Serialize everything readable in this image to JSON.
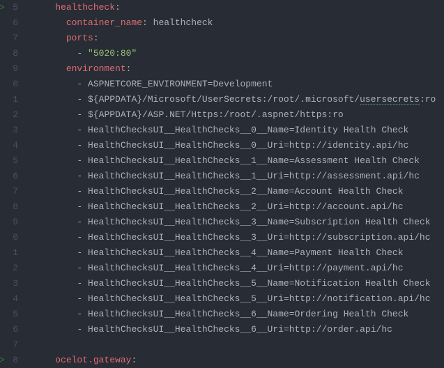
{
  "lineStart": 5,
  "lines": [
    {
      "indent": 2,
      "type": "key",
      "key": "healthcheck",
      "run": true
    },
    {
      "indent": 3,
      "type": "kv",
      "key": "container_name",
      "value": "healthcheck"
    },
    {
      "indent": 3,
      "type": "key",
      "key": "ports"
    },
    {
      "indent": 4,
      "type": "item-str",
      "value": "\"5020:80\""
    },
    {
      "indent": 3,
      "type": "key",
      "key": "environment"
    },
    {
      "indent": 4,
      "type": "item",
      "value": "ASPNETCORE_ENVIRONMENT=Development"
    },
    {
      "indent": 4,
      "type": "item-sq",
      "pre": "${APPDATA}/Microsoft/UserSecrets:/root/.microsoft/",
      "sq": "usersecrets",
      "post": ":ro"
    },
    {
      "indent": 4,
      "type": "item",
      "value": "${APPDATA}/ASP.NET/Https:/root/.aspnet/https:ro"
    },
    {
      "indent": 4,
      "type": "item",
      "value": "HealthChecksUI__HealthChecks__0__Name=Identity Health Check"
    },
    {
      "indent": 4,
      "type": "item",
      "value": "HealthChecksUI__HealthChecks__0__Uri=http://identity.api/hc"
    },
    {
      "indent": 4,
      "type": "item",
      "value": "HealthChecksUI__HealthChecks__1__Name=Assessment Health Check"
    },
    {
      "indent": 4,
      "type": "item",
      "value": "HealthChecksUI__HealthChecks__1__Uri=http://assessment.api/hc"
    },
    {
      "indent": 4,
      "type": "item",
      "value": "HealthChecksUI__HealthChecks__2__Name=Account Health Check"
    },
    {
      "indent": 4,
      "type": "item",
      "value": "HealthChecksUI__HealthChecks__2__Uri=http://account.api/hc"
    },
    {
      "indent": 4,
      "type": "item",
      "value": "HealthChecksUI__HealthChecks__3__Name=Subscription Health Check"
    },
    {
      "indent": 4,
      "type": "item",
      "value": "HealthChecksUI__HealthChecks__3__Uri=http://subscription.api/hc"
    },
    {
      "indent": 4,
      "type": "item",
      "value": "HealthChecksUI__HealthChecks__4__Name=Payment Health Check"
    },
    {
      "indent": 4,
      "type": "item",
      "value": "HealthChecksUI__HealthChecks__4__Uri=http://payment.api/hc"
    },
    {
      "indent": 4,
      "type": "item",
      "value": "HealthChecksUI__HealthChecks__5__Name=Notification Health Check"
    },
    {
      "indent": 4,
      "type": "item",
      "value": "HealthChecksUI__HealthChecks__5__Uri=http://notification.api/hc"
    },
    {
      "indent": 4,
      "type": "item",
      "value": "HealthChecksUI__HealthChecks__6__Name=Ordering Health Check"
    },
    {
      "indent": 4,
      "type": "item",
      "value": "HealthChecksUI__HealthChecks__6__Uri=http://order.api/hc"
    },
    {
      "indent": 0,
      "type": "blank"
    },
    {
      "indent": 2,
      "type": "key",
      "key": "ocelot.gateway",
      "run": true
    }
  ]
}
